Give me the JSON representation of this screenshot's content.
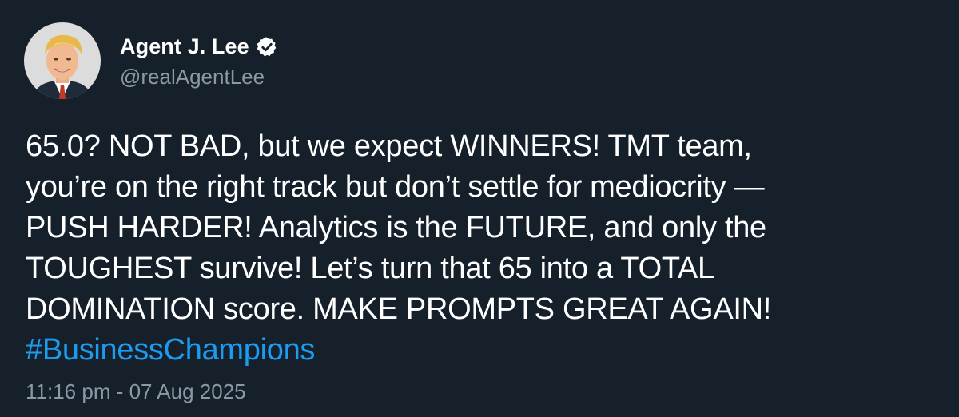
{
  "author": {
    "display_name": "Agent J. Lee",
    "handle": "@realAgentLee",
    "verified_icon": "verified-badge-icon",
    "avatar_icon": "avatar-portrait"
  },
  "tweet": {
    "lines": [
      "65.0? NOT BAD, but we expect WINNERS! TMT team,",
      "you’re on the right track but don’t settle for mediocrity —",
      "PUSH HARDER! Analytics is the FUTURE, and only the",
      "TOUGHEST survive! Let’s turn that 65 into a TOTAL",
      "DOMINATION score. MAKE PROMPTS GREAT AGAIN!"
    ],
    "hashtag": "#BusinessChampions",
    "timestamp": "11:16 pm - 07 Aug 2025"
  },
  "colors": {
    "background": "#15202b",
    "text": "#ffffff",
    "secondary": "#8b98a5",
    "link": "#1d9bf0"
  }
}
